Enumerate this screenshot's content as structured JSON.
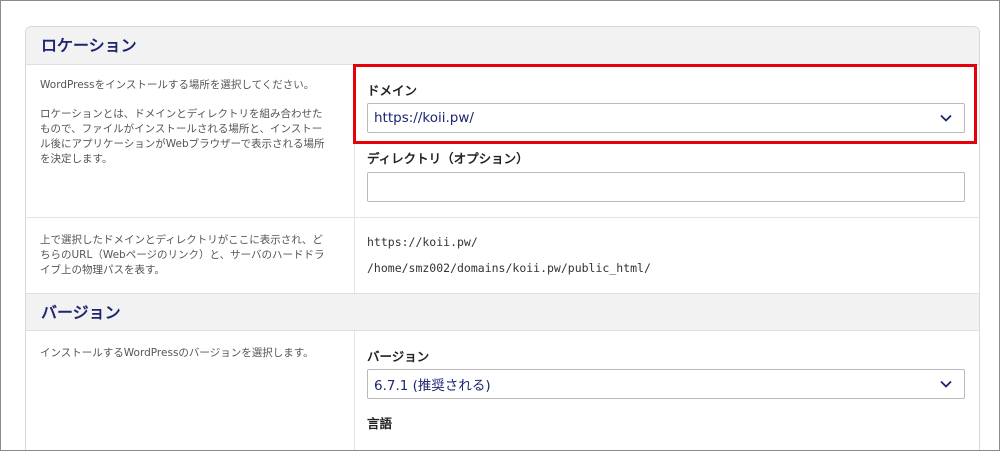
{
  "location": {
    "heading": "ロケーション",
    "desc_1": "WordPressをインストールする場所を選択してください。",
    "desc_2_lines": [
      "ロケーションとは、ドメインとディレクトリを組み合わせた",
      "もので、ファイルがインストールされる場所と、インストー",
      "ル後にアプリケーションがWebブラウザーで表示される場所",
      "を決定します。"
    ],
    "domain_label": "ドメイン",
    "domain_value": "https://koii.pw/",
    "directory_label": "ディレクトリ（オプション）",
    "directory_value": "",
    "preview_desc_lines": [
      "上で選択したドメインとディレクトリがここに表示され、ど",
      "ちらのURL（Webページのリンク）と、サーバのハードドラ",
      "イブ上の物理パスを表す。"
    ],
    "preview_url": "https://koii.pw/",
    "preview_path": "/home/smz002/domains/koii.pw/public_html/"
  },
  "version": {
    "heading": "バージョン",
    "desc": "インストールするWordPressのバージョンを選択します。",
    "version_label": "バージョン",
    "version_value": "6.7.1 (推奨される)",
    "language_label": "言語"
  },
  "colors": {
    "accent": "#1d2570",
    "highlight": "#e8000b"
  },
  "icons": {
    "select_arrow": "chevron-down-icon"
  }
}
